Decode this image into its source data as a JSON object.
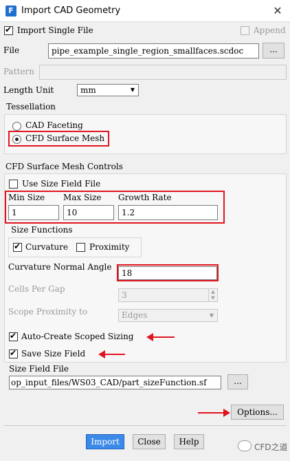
{
  "window": {
    "title": "Import CAD Geometry",
    "app_icon": "F",
    "close_glyph": "✕"
  },
  "import_single_file": {
    "label": "Import Single File",
    "checked": true
  },
  "append": {
    "label": "Append",
    "checked": false
  },
  "file": {
    "label": "File",
    "value": "pipe_example_single_region_smallfaces.scdoc",
    "browse_label": "..."
  },
  "pattern": {
    "label": "Pattern",
    "value": ""
  },
  "length_unit": {
    "label": "Length Unit",
    "value": "mm"
  },
  "tessellation": {
    "title": "Tessellation",
    "options": [
      {
        "label": "CAD Faceting",
        "selected": false
      },
      {
        "label": "CFD Surface Mesh",
        "selected": true
      }
    ]
  },
  "mesh_controls": {
    "title": "CFD Surface Mesh Controls",
    "use_size_field_file": {
      "label": "Use Size Field File",
      "checked": false
    },
    "min_size": {
      "label": "Min Size",
      "value": "1"
    },
    "max_size": {
      "label": "Max Size",
      "value": "10"
    },
    "growth_rate": {
      "label": "Growth Rate",
      "value": "1.2"
    },
    "size_functions": {
      "title": "Size Functions",
      "curvature": {
        "label": "Curvature",
        "checked": true
      },
      "proximity": {
        "label": "Proximity",
        "checked": false
      }
    },
    "curvature_normal_angle": {
      "label": "Curvature Normal Angle",
      "value": "18"
    },
    "cells_per_gap": {
      "label": "Cells Per Gap",
      "value": "3"
    },
    "scope_proximity_to": {
      "label": "Scope Proximity to",
      "value": "Edges"
    }
  },
  "auto_create_scoped_sizing": {
    "label": "Auto-Create Scoped Sizing",
    "checked": true
  },
  "save_size_field": {
    "label": "Save Size Field",
    "checked": true
  },
  "size_field_file": {
    "label": "Size Field File",
    "value": "op_input_files/WS03_CAD/part_sizeFunction.sf",
    "browse_label": "..."
  },
  "options_button": {
    "label": "Options..."
  },
  "footer": {
    "import_label": "Import",
    "close_label": "Close",
    "help_label": "Help"
  },
  "watermark": {
    "text": "CFD之道"
  },
  "colors": {
    "accent_blue": "#1f6fd1",
    "highlight_red": "#e0141e",
    "import_button": "#3c8ae8"
  }
}
